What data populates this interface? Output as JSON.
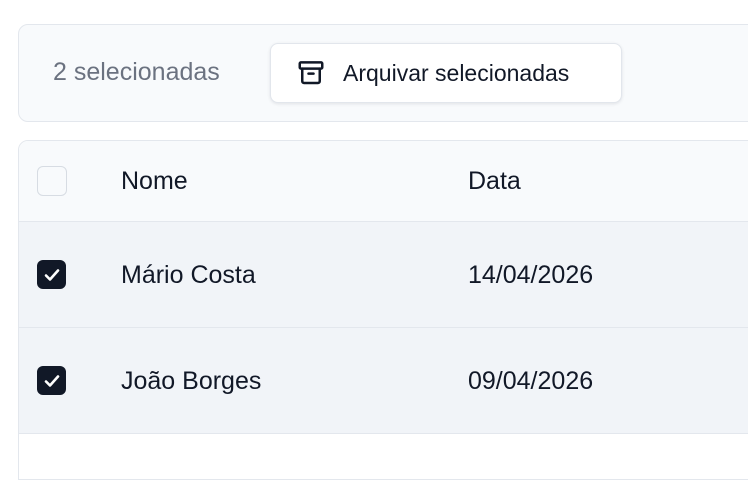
{
  "toolbar": {
    "selected_count_text": "2 selecionadas",
    "archive_button_label": "Arquivar selecionadas",
    "archive_icon": "archive-icon"
  },
  "table": {
    "columns": [
      "Nome",
      "Data"
    ],
    "select_all_checked": false,
    "rows": [
      {
        "nome": "Mário Costa",
        "data": "14/04/2026",
        "checked": true
      },
      {
        "nome": "João Borges",
        "data": "09/04/2026",
        "checked": true
      }
    ]
  },
  "colors": {
    "checkbox_checked": "#111827",
    "text_muted": "#6b7280",
    "selected_row_bg": "#f1f4f8",
    "border": "#e3e7ed"
  }
}
